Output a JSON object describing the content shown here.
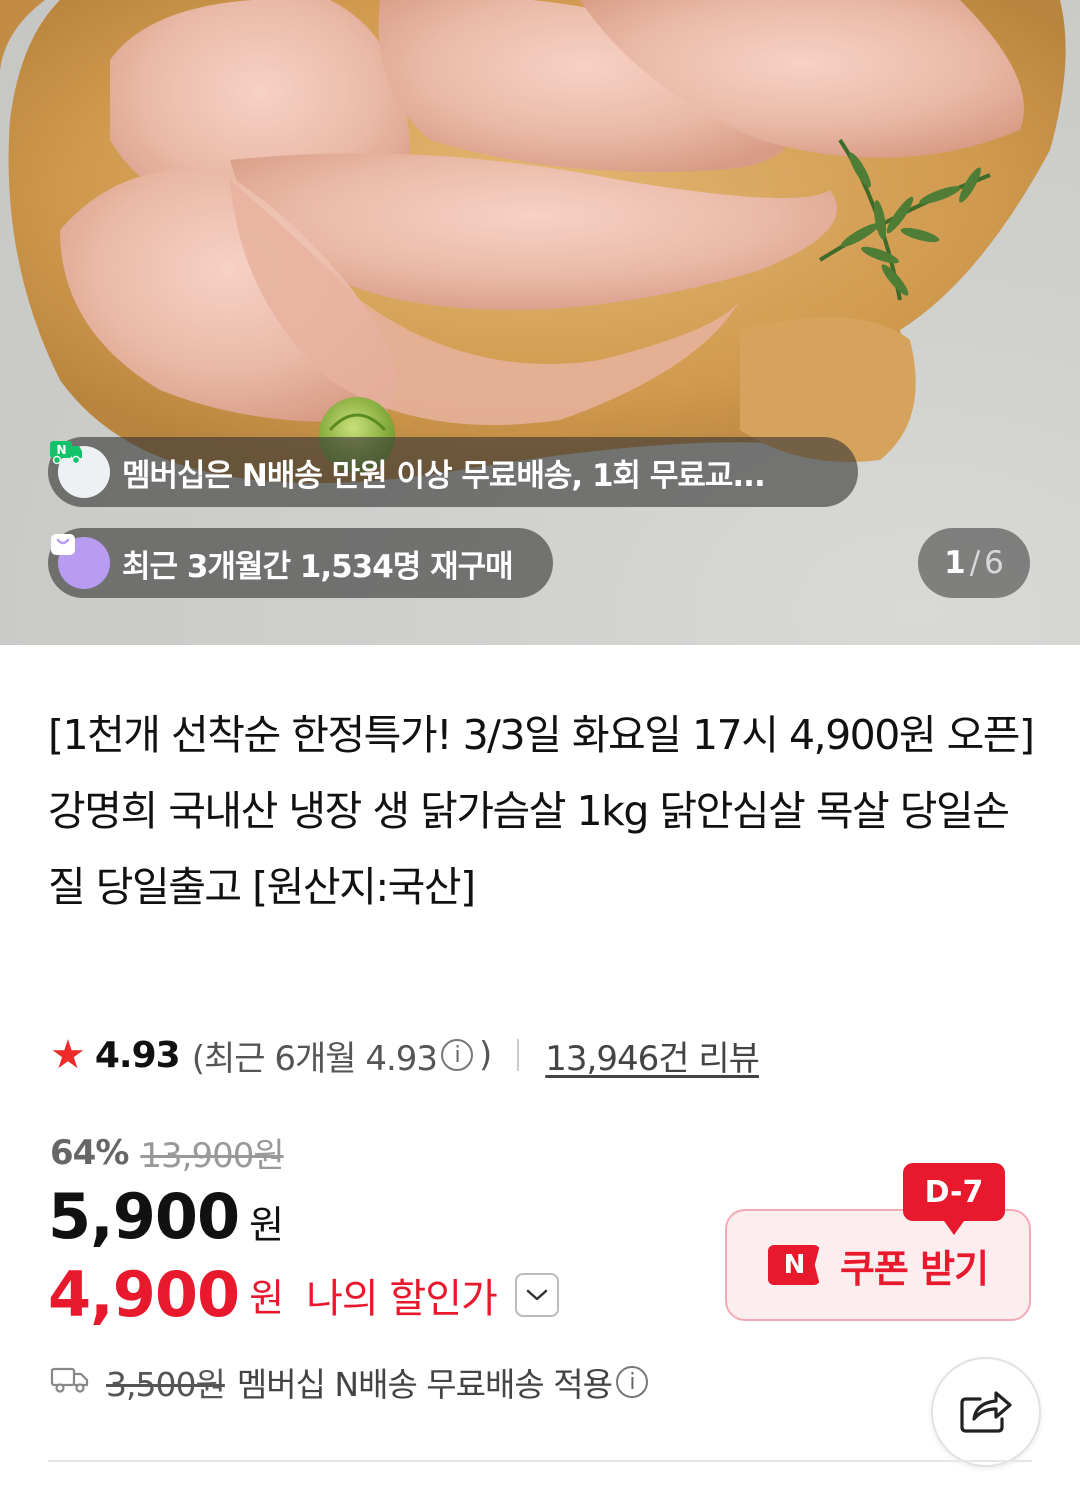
{
  "hero": {
    "image_alt": "",
    "membership_badge": "멤버십은 N배송 만원 이상 무료배송, 1회 무료교...",
    "membership_icon": "n-delivery-truck-icon",
    "rebuy_badge": "최근 3개월간 1,534명 재구매",
    "rebuy_icon": "shopping-bag-icon",
    "page_current": "1",
    "page_separator": "/",
    "page_total": "6"
  },
  "product": {
    "title": "[1천개 선착순 한정특가! 3/3일 화요일 17시 4,900원 오픈] 강명희 국내산 냉장 생 닭가슴살 1kg 닭안심살 목살 당일손질 당일출고 [원산지:국산]"
  },
  "rating": {
    "score": "4.93",
    "recent_prefix": "(최근 6개월 4.93",
    "recent_suffix": ")",
    "reviews": "13,946건 리뷰"
  },
  "price": {
    "discount_pct": "64%",
    "original": "13,900원",
    "sale_amount": "5,900",
    "unit": "원",
    "my_price_amount": "4,900",
    "my_price_unit": "원",
    "my_price_label": "나의 할인가"
  },
  "coupon": {
    "label": "쿠폰 받기",
    "logo": "N",
    "dday": "D-7"
  },
  "shipping": {
    "fee": "3,500원",
    "text": "멤버십 N배송 무료배송 적용"
  },
  "colors": {
    "accent_red": "#e8192c",
    "coupon_bg": "#fcedef",
    "rebuy_icon_bg": "#b79cf2"
  }
}
